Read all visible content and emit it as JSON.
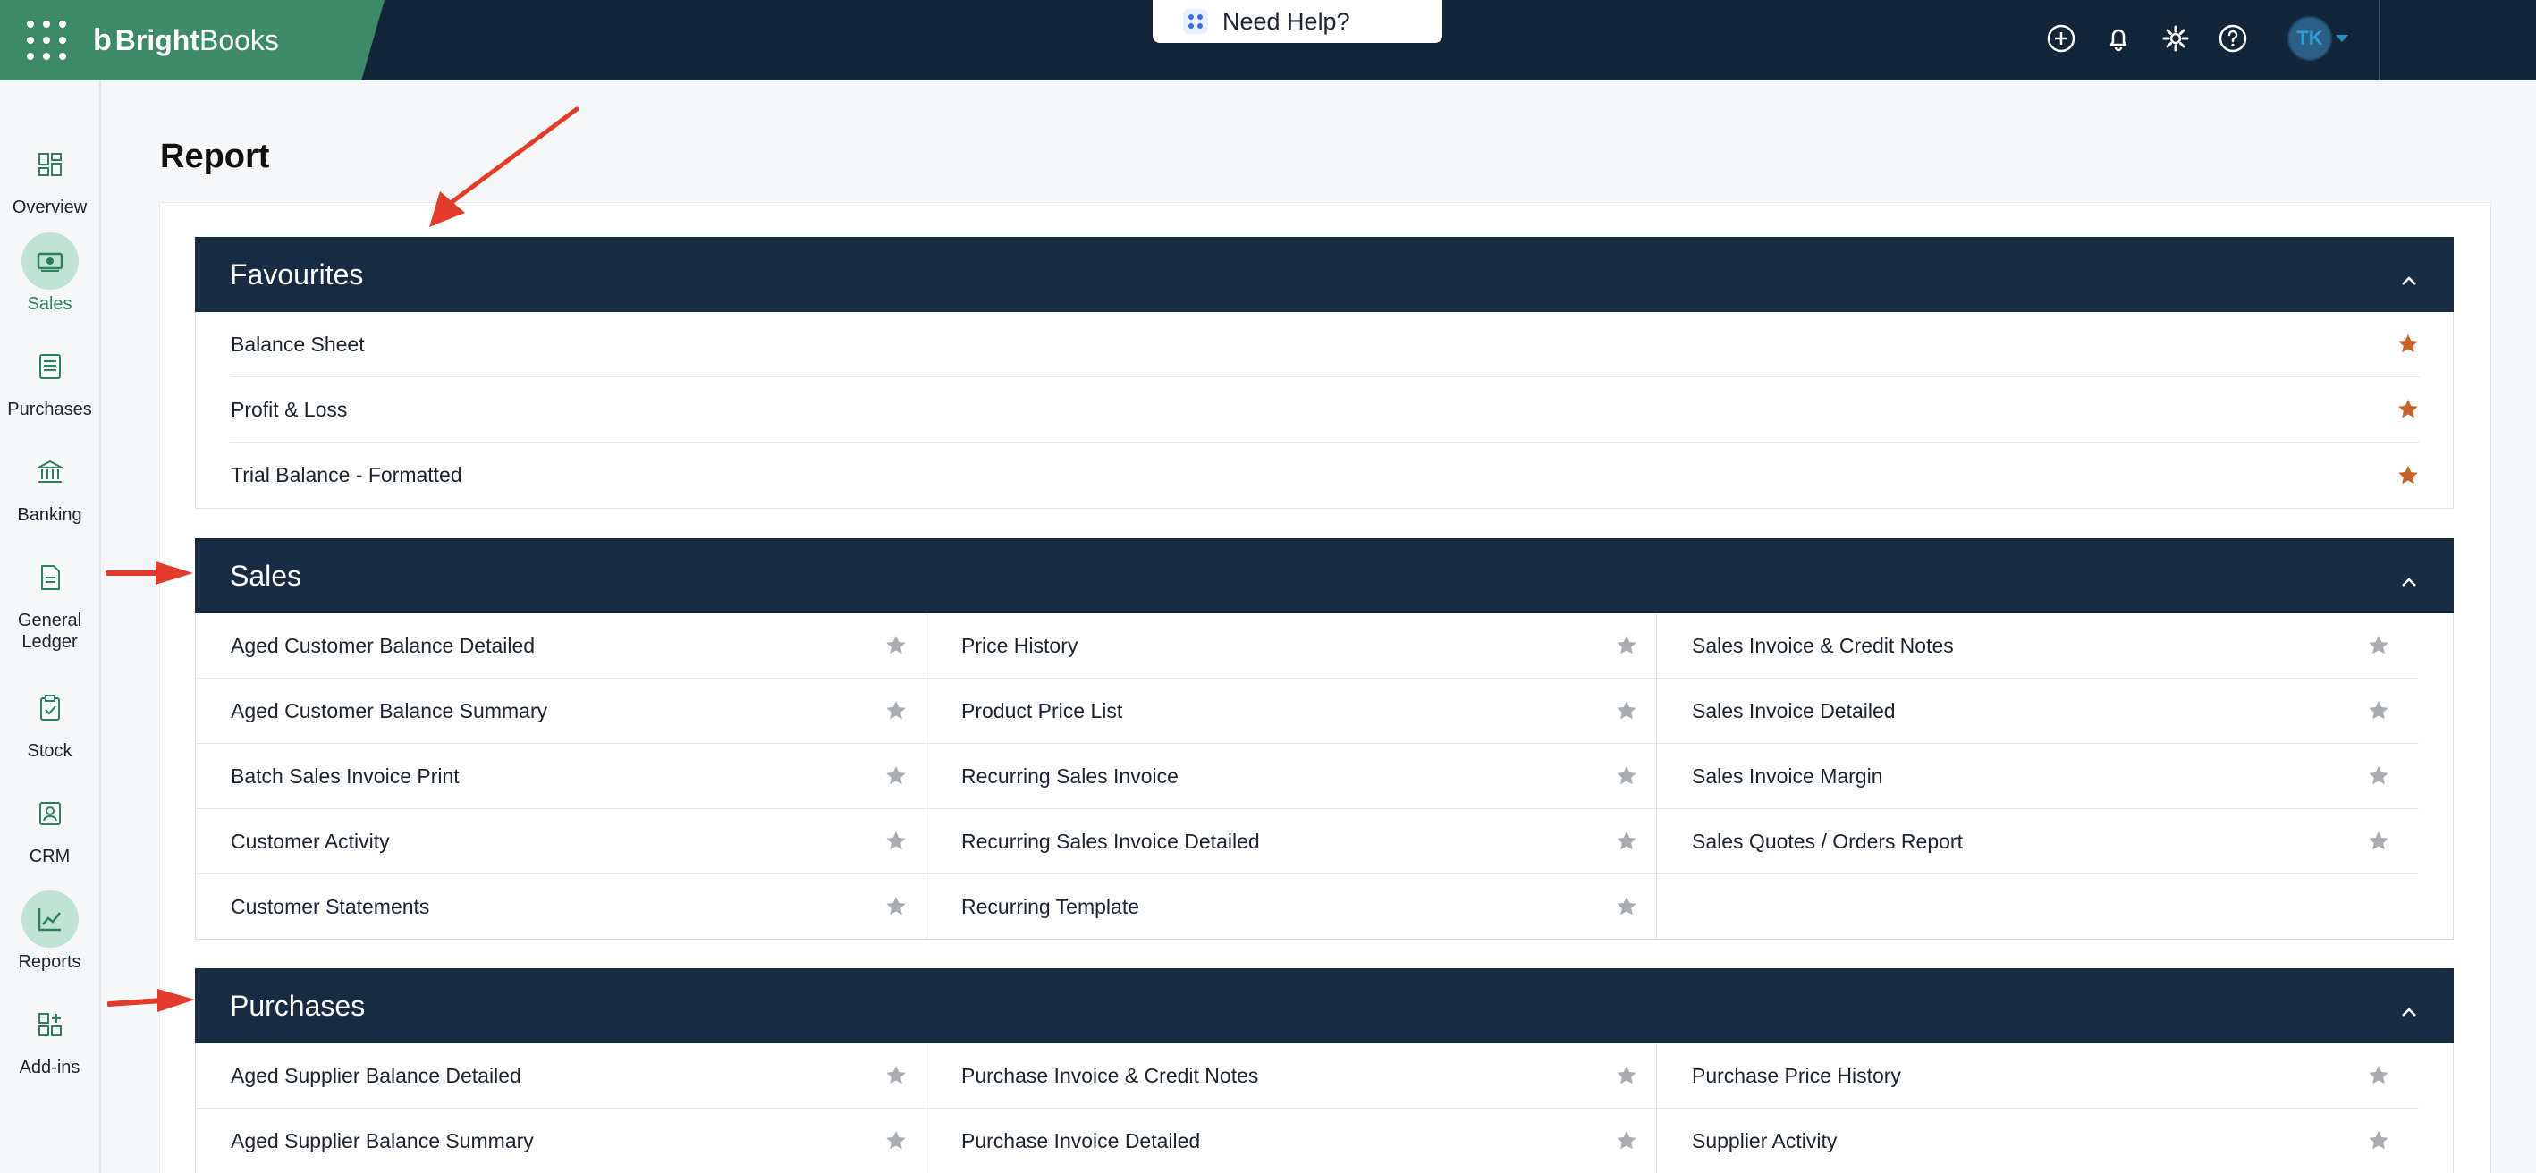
{
  "header": {
    "brand_name_bold": "Bright",
    "brand_name_light": "Books",
    "help_label": "Need Help?",
    "avatar_initials": "TK"
  },
  "sidebar": {
    "items": [
      {
        "label": "Overview",
        "icon": "dashboard-icon"
      },
      {
        "label": "Sales",
        "icon": "money-icon",
        "active": true
      },
      {
        "label": "Purchases",
        "icon": "receipt-icon"
      },
      {
        "label": "Banking",
        "icon": "bank-icon"
      },
      {
        "label": "General Ledger",
        "icon": "document-icon"
      },
      {
        "label": "Stock",
        "icon": "clipboard-check-icon"
      },
      {
        "label": "CRM",
        "icon": "contact-card-icon"
      },
      {
        "label": "Reports",
        "icon": "chart-icon",
        "active": true
      },
      {
        "label": "Add-ins",
        "icon": "apps-add-icon"
      }
    ]
  },
  "page": {
    "title": "Report"
  },
  "sections": {
    "favourites": {
      "title": "Favourites",
      "items": [
        "Balance Sheet",
        "Profit & Loss",
        "Trial Balance - Formatted"
      ]
    },
    "sales": {
      "title": "Sales",
      "col1": [
        "Aged Customer Balance Detailed",
        "Aged Customer Balance Summary",
        "Batch Sales Invoice Print",
        "Customer Activity",
        "Customer Statements"
      ],
      "col2": [
        "Price History",
        "Product Price List",
        "Recurring Sales Invoice",
        "Recurring Sales Invoice Detailed",
        "Recurring Template"
      ],
      "col3": [
        "Sales Invoice & Credit Notes",
        "Sales Invoice Detailed",
        "Sales Invoice Margin",
        "Sales Quotes / Orders Report"
      ]
    },
    "purchases": {
      "title": "Purchases",
      "col1": [
        "Aged Supplier Balance Detailed",
        "Aged Supplier Balance Summary"
      ],
      "col2": [
        "Purchase Invoice & Credit Notes",
        "Purchase Invoice Detailed"
      ],
      "col3": [
        "Purchase Price History",
        "Supplier Activity"
      ]
    }
  },
  "colors": {
    "topbar": "#132538",
    "brand_green": "#3d8a68",
    "section_header": "#172b42",
    "favourite_star": "#c8642a",
    "inactive_star": "#a9adb2",
    "annotation_arrow": "#e53b2c"
  }
}
